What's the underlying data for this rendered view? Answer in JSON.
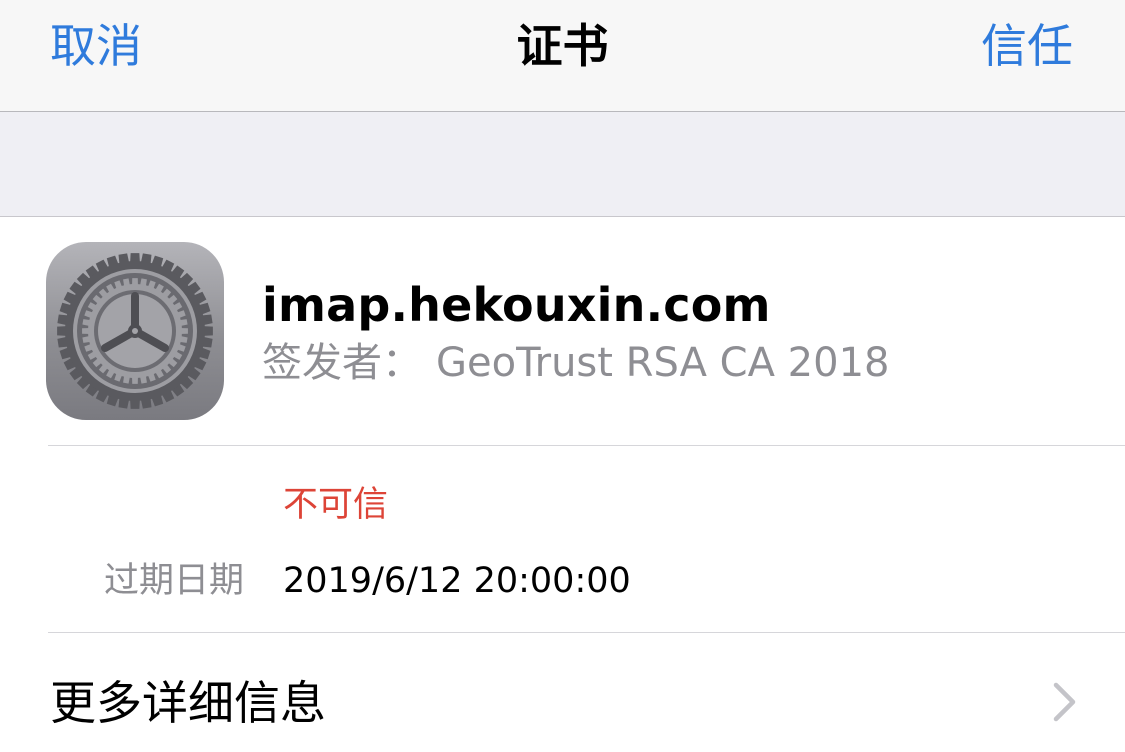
{
  "navbar": {
    "cancel_label": "取消",
    "title": "证书",
    "trust_label": "信任"
  },
  "certificate": {
    "icon": "settings-gear-icon",
    "name": "imap.hekouxin.com",
    "issuer_label": "签发者：",
    "issuer_value": "GeoTrust RSA CA 2018",
    "status": "不可信",
    "expiry_label": "过期日期",
    "expiry_value": "2019/6/12 20:00:00"
  },
  "more_details": {
    "label": "更多详细信息",
    "icon": "chevron-right-icon"
  },
  "colors": {
    "accent": "#2f7bdc",
    "warning": "#dd4437",
    "secondary_text": "#8e8e93",
    "navbar_bg": "#f7f7f7",
    "group_bg": "#efeff4"
  }
}
